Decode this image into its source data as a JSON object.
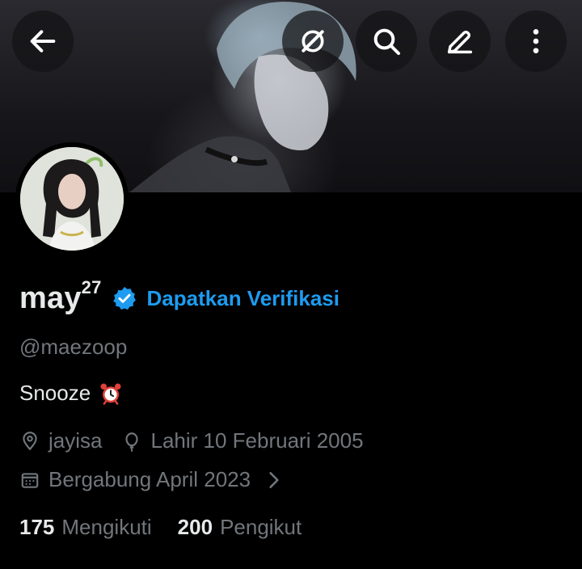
{
  "header": {
    "back_icon": "arrow-left-icon",
    "grok_icon": "slash-circle-icon",
    "search_icon": "search-icon",
    "edit_icon": "pencil-icon",
    "more_icon": "more-vertical-icon"
  },
  "profile": {
    "name": "may",
    "name_superscript": "27",
    "get_verified_label": "Dapatkan Verifikasi",
    "handle": "@maezoop",
    "bio": "Snooze",
    "bio_emoji": "alarm-clock-icon",
    "location": "jayisa",
    "birthday": "Lahir 10 Februari 2005",
    "joined": "Bergabung April 2023",
    "following_count": "175",
    "following_label": "Mengikuti",
    "followers_count": "200",
    "followers_label": "Pengikut"
  },
  "colors": {
    "accent": "#1d9bf0",
    "secondary_text": "#71767b",
    "primary_text": "#e7e9ea",
    "background": "#000000"
  }
}
